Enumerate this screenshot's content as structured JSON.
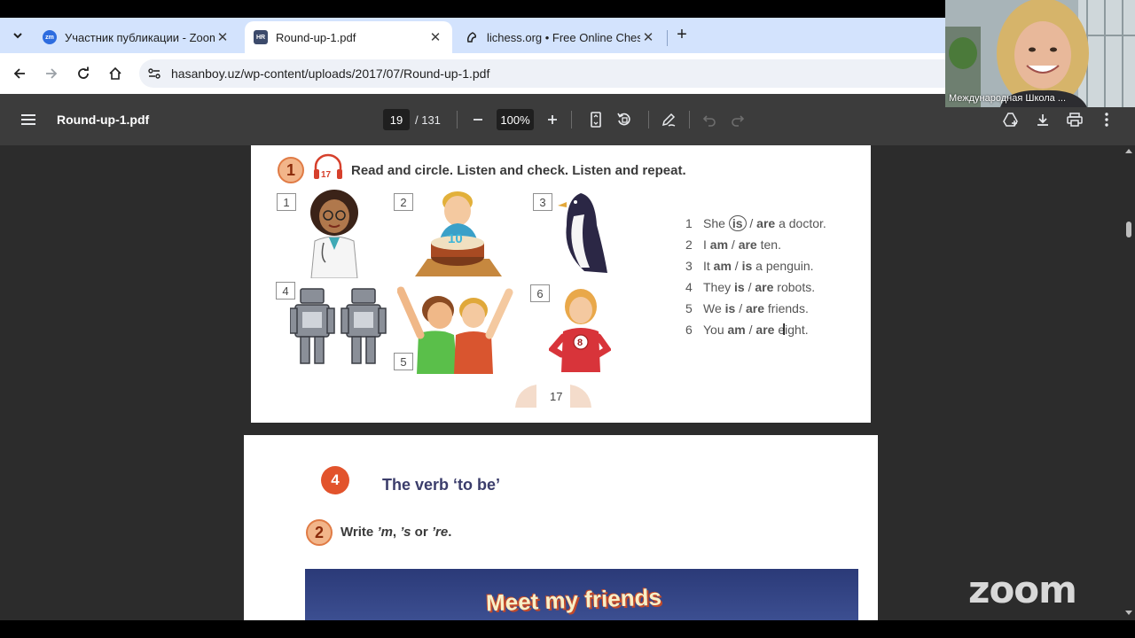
{
  "tabs": [
    {
      "label": "Участник публикации - Zoom",
      "favicon": "zoom-icon"
    },
    {
      "label": "Round-up-1.pdf",
      "favicon": "hr-icon"
    },
    {
      "label": "lichess.org • Free Online Chess",
      "favicon": "lichess-icon"
    }
  ],
  "tab_favicon_texts": [
    "zm",
    "HR"
  ],
  "address": {
    "url": "hasanboy.uz/wp-content/uploads/2017/07/Round-up-1.pdf"
  },
  "pdf_toolbar": {
    "title": "Round-up-1.pdf",
    "page": "19",
    "total": "/ 131",
    "zoom": "100%"
  },
  "page1": {
    "exercise_number": "1",
    "audio_track": "17",
    "instruction": "Read and circle. Listen and check. Listen and repeat.",
    "picture_numbers": [
      "1",
      "2",
      "3",
      "4",
      "5",
      "6"
    ],
    "sentences": [
      {
        "n": "1",
        "subject": "She",
        "opt1": "is",
        "opt2": "are",
        "rest": "a doctor."
      },
      {
        "n": "2",
        "subject": "I",
        "opt1": "am",
        "opt2": "are",
        "rest": "ten."
      },
      {
        "n": "3",
        "subject": "It",
        "opt1": "am",
        "opt2": "is",
        "rest": "a penguin."
      },
      {
        "n": "4",
        "subject": "They",
        "opt1": "is",
        "opt2": "are",
        "rest": "robots."
      },
      {
        "n": "5",
        "subject": "We",
        "opt1": "is",
        "opt2": "are",
        "rest": "friends."
      },
      {
        "n": "6",
        "subject": "You",
        "opt1": "am",
        "opt2": "are",
        "rest": "eight."
      }
    ],
    "cake_number": "10",
    "girl_number": "8",
    "page_number": "17"
  },
  "page2": {
    "section_number": "4",
    "section_title": "The verb ‘to be’",
    "exercise_number": "2",
    "instruction_prefix": "Write ",
    "instruction_m": "’m",
    "instruction_sep": ", ",
    "instruction_s": "’s",
    "instruction_or": " or ",
    "instruction_re": "’re",
    "instruction_end": ".",
    "banner_text": "Meet my friends"
  },
  "zoom_overlay": {
    "participant_name": "Международная Школа ...",
    "logo_text": "zoom"
  }
}
